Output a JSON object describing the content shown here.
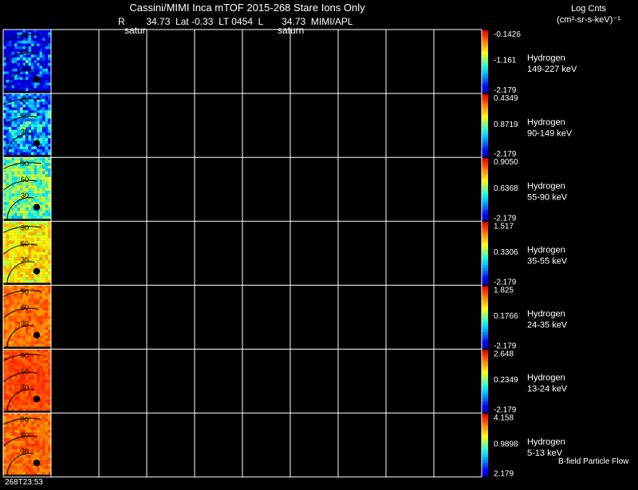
{
  "header": {
    "title": "Cassini/MIMI Inca mTOF  2015-268   Stare   Ions Only",
    "subtitle": "R        34.73  Lat -0.33  LT 0454  L       34.73  MIMI/APL",
    "saturn_label_1": "satur",
    "saturn_label_2": "saturn",
    "units_line1": "Log Cnts",
    "units_line2": "(cm²-sr-s-keV)⁻¹",
    "footer_time": "268T23:53",
    "footer_note": "B-field Particle Flow"
  },
  "colors": {
    "background": "#000000",
    "grid": "#ffffff",
    "colorbar": [
      "#0000c8",
      "#0000ff",
      "#0050ff",
      "#00a0ff",
      "#00e0ff",
      "#40ffc0",
      "#a0ff60",
      "#ffff00",
      "#ffc000",
      "#ff8000",
      "#ff3000",
      "#e00000"
    ]
  },
  "chart_data": {
    "type": "heatmap",
    "panels": [
      {
        "species": "Hydrogen",
        "energy": "149-227 keV",
        "cb_max": "-0.1426",
        "cb_mid": "-1.161",
        "cb_min": "-2.179",
        "level": 0.18,
        "variability": 0.32,
        "ticks": [
          "90",
          "60",
          "30"
        ]
      },
      {
        "species": "Hydrogen",
        "energy": "90-149 keV",
        "cb_max": "0.4349",
        "cb_mid": "0.8719",
        "cb_min": "-2.179",
        "level": 0.36,
        "variability": 0.22,
        "ticks": [
          "90",
          "60",
          "30"
        ]
      },
      {
        "species": "Hydrogen",
        "energy": "55-90 keV",
        "cb_max": "0.9050",
        "cb_mid": "0.6368",
        "cb_min": "-2.179",
        "level": 0.55,
        "variability": 0.16,
        "ticks": [
          "90",
          "60",
          "30"
        ]
      },
      {
        "species": "Hydrogen",
        "energy": "35-55 keV",
        "cb_max": "1.517",
        "cb_mid": "0.3306",
        "cb_min": "-2.179",
        "level": 0.72,
        "variability": 0.12,
        "ticks": [
          "90",
          "60",
          "30"
        ]
      },
      {
        "species": "Hydrogen",
        "energy": "24-35 keV",
        "cb_max": "1.825",
        "cb_mid": "0.1766",
        "cb_min": "-2.179",
        "level": 0.86,
        "variability": 0.07,
        "ticks": [
          "90",
          "60",
          "30"
        ]
      },
      {
        "species": "Hydrogen",
        "energy": "13-24 keV",
        "cb_max": "2.648",
        "cb_mid": "0.2349",
        "cb_min": "-2.179",
        "level": 0.9,
        "variability": 0.05,
        "ticks": [
          "90",
          "60",
          "30"
        ]
      },
      {
        "species": "Hydrogen",
        "energy": "5-13 keV",
        "cb_max": "4.158",
        "cb_mid": "0.9898",
        "cb_min": "2.179",
        "level": 0.87,
        "variability": 0.07,
        "ticks": [
          "90",
          "60",
          "30"
        ]
      }
    ],
    "columns_per_row": 10,
    "filled_columns": 1
  }
}
